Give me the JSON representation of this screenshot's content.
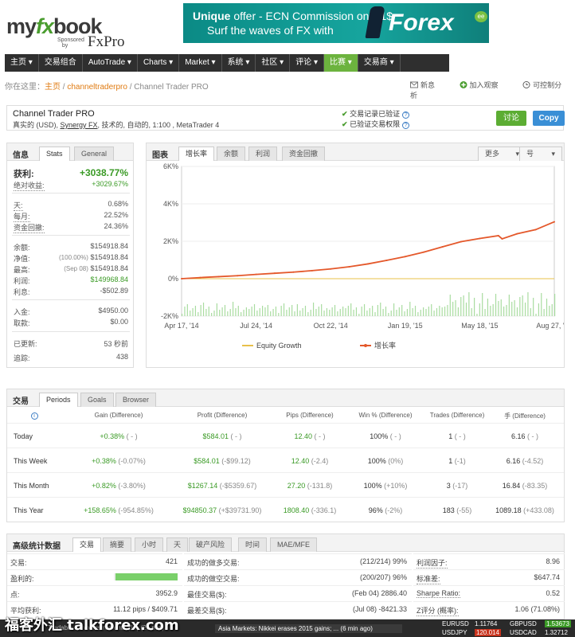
{
  "brand": {
    "my": "my",
    "fx": "fx",
    "book": "book",
    "sponsored": "Sponsored",
    "by": "by",
    "fxpro": "FxPro"
  },
  "banner": {
    "line1_a": "Unique",
    "line1_b": " offer - ECN Commission only 1$",
    "line2": "Surf the waves of FX with",
    "forex": "Forex",
    "ee": "ee"
  },
  "nav": [
    "主页 ▾",
    "交易组合",
    "AutoTrade ▾",
    "Charts ▾",
    "Market ▾",
    "系统 ▾",
    "社区 ▾",
    "评论 ▾",
    "比赛 ▾",
    "交易商 ▾"
  ],
  "breadcrumb": {
    "prefix": "你在这里：",
    "home": "主页",
    "sep1": " / ",
    "sys": "channeltraderpro",
    "sep2": " / ",
    "current": "Channel Trader PRO"
  },
  "tools": {
    "notice": "新息",
    "add": "加入观察",
    "analyze": "可控制分析"
  },
  "system": {
    "name": "Channel Trader PRO",
    "desc_a": "真实的 (USD), ",
    "broker": "Synergy FX",
    "desc_b": ", 技术的, 自动的, 1:100 , MetaTrader 4",
    "check1": "交易记录已验证",
    "check2": "已验证交易权限",
    "discuss": "讨论",
    "copy": "Copy"
  },
  "info": {
    "tabs": [
      "信息",
      "Stats",
      "General"
    ],
    "gain_label": "获利:",
    "gain": "+3038.77%",
    "abs_label": "绝对收益:",
    "abs": "+3029.67%",
    "daily_label": "天:",
    "daily": "0.68%",
    "monthly_label": "每月:",
    "monthly": "22.52%",
    "dd_label": "资金回撤:",
    "dd": "24.36%",
    "bal_label": "余额:",
    "bal": "$154918.84",
    "eq_label": "净值:",
    "eq_pct": "(100.00%)",
    "eq": "$154918.84",
    "high_label": "最高:",
    "high_date": "(Sep 08)",
    "high": "$154918.84",
    "profit_label": "利润:",
    "profit": "$149968.84",
    "int_label": "利息:",
    "int": "-$502.89",
    "dep_label": "入金:",
    "dep": "$4950.00",
    "wd_label": "取款:",
    "wd": "$0.00",
    "upd_label": "已更新:",
    "upd": "53 秒前",
    "track_label": "追踪:",
    "track": "438"
  },
  "chart_panel": {
    "tabs": [
      "图表",
      "增长率",
      "余额",
      "利润",
      "资金回撤"
    ],
    "more": "更多",
    "week": "号"
  },
  "chart_data": {
    "type": "line",
    "yticks": [
      "6K%",
      "4K%",
      "2K%",
      "0%",
      "-2K%"
    ],
    "yvalues": [
      6000,
      4000,
      2000,
      0,
      -2000
    ],
    "ylim": [
      -2000,
      6000
    ],
    "xticks": [
      "Apr 17, '14",
      "Jul 24, '14",
      "Oct 22, '14",
      "Jan 19, '15",
      "May 18, '15",
      "Aug 27, '15"
    ],
    "legend": [
      "Equity Growth",
      "增长率"
    ],
    "series": [
      {
        "name": "增长率",
        "color": "#e4582b",
        "x": [
          0,
          0.05,
          0.1,
          0.15,
          0.2,
          0.25,
          0.3,
          0.35,
          0.4,
          0.45,
          0.5,
          0.55,
          0.6,
          0.65,
          0.7,
          0.75,
          0.8,
          0.85,
          0.86,
          0.9,
          0.95,
          1.0
        ],
        "values": [
          0,
          60,
          110,
          160,
          230,
          290,
          350,
          430,
          520,
          640,
          790,
          980,
          1180,
          1420,
          1700,
          1980,
          2150,
          2300,
          2130,
          2400,
          2620,
          3039
        ]
      },
      {
        "name": "Equity Growth",
        "color": "#e8c04a",
        "x": [
          0,
          1
        ],
        "values": [
          0,
          0
        ]
      }
    ]
  },
  "periods": {
    "tabs": [
      "交易",
      "Periods",
      "Goals",
      "Browser"
    ],
    "headers": [
      "Gain (Difference)",
      "Profit (Difference)",
      "Pips (Difference)",
      "Win % (Difference)",
      "Trades (Difference)",
      "手 (Difference)"
    ],
    "rows": [
      {
        "label": "Today",
        "gain": "+0.38%",
        "gain_d": "( - )",
        "profit": "$584.01",
        "profit_d": "( - )",
        "pips": "12.40",
        "pips_d": "( - )",
        "win": "100%",
        "win_d": "( - )",
        "trades": "1",
        "trades_d": "( - )",
        "lots": "6.16",
        "lots_d": "( - )"
      },
      {
        "label": "This Week",
        "gain": "+0.38%",
        "gain_d": "(-0.07%)",
        "profit": "$584.01",
        "profit_d": "(-$99.12)",
        "pips": "12.40",
        "pips_d": "(-2.4)",
        "win": "100%",
        "win_d": "(0%)",
        "trades": "1",
        "trades_d": "(-1)",
        "lots": "6.16",
        "lots_d": "(-4.52)"
      },
      {
        "label": "This Month",
        "gain": "+0.82%",
        "gain_d": "(-3.80%)",
        "profit": "$1267.14",
        "profit_d": "(-$5359.67)",
        "pips": "27.20",
        "pips_d": "(-131.8)",
        "win": "100%",
        "win_d": "(+10%)",
        "trades": "3",
        "trades_d": "(-17)",
        "lots": "16.84",
        "lots_d": "(-83.35)"
      },
      {
        "label": "This Year",
        "gain": "+158.65%",
        "gain_d": "(-954.85%)",
        "profit": "$94850.37",
        "profit_d": "(+$39731.90)",
        "pips": "1808.40",
        "pips_d": "(-336.1)",
        "win": "96%",
        "win_d": "(-2%)",
        "trades": "183",
        "trades_d": "(-55)",
        "lots": "1089.18",
        "lots_d": "(+433.08)"
      }
    ]
  },
  "advanced": {
    "title": "高级统计数据",
    "tabs": [
      "交易",
      "摘要",
      "小时",
      "天",
      "破产风险",
      "时间",
      "MAE/MFE"
    ],
    "col1": [
      {
        "k": "交易:",
        "v": "421"
      },
      {
        "k": "盈利的:",
        "v": ""
      },
      {
        "k": "点:",
        "v": "3952.9"
      },
      {
        "k": "平均获利:",
        "v": "11.12 pips / $409.71"
      }
    ],
    "col2": [
      {
        "k": "成功的做多交易:",
        "v": "(212/214) 99%"
      },
      {
        "k": "成功的做空交易:",
        "v": "(200/207) 96%"
      },
      {
        "k": "最佳交易($):",
        "v": "(Feb 04) 2886.40"
      },
      {
        "k": "最差交易($):",
        "v": "(Jul 08) -8421.33"
      }
    ],
    "col3": [
      {
        "k": "利润因子:",
        "v": "8.96"
      },
      {
        "k": "标准差:",
        "v": "$647.74"
      },
      {
        "k": "Sharpe Ratio:",
        "v": "0.52"
      },
      {
        "k": "Z评分 (概率):",
        "v": "1.06 (71.08%)"
      }
    ],
    "profitable_fraction": 0.97
  },
  "footer": {
    "left": "Tradable Forex Instruments (1h) (23 min)",
    "news": "Asia Markets: Nikkei erases 2015 gains; ... (6 min ago)",
    "q1": "EURUSD",
    "q1v": "1.11764",
    "q2": "GBPUSD",
    "q2v": "1.53673",
    "q3": "USDJPY",
    "q3v": "120.014",
    "q4": "USDCAD",
    "q4v": "1.32712"
  },
  "watermark": "福客外汇 talkforex.com"
}
